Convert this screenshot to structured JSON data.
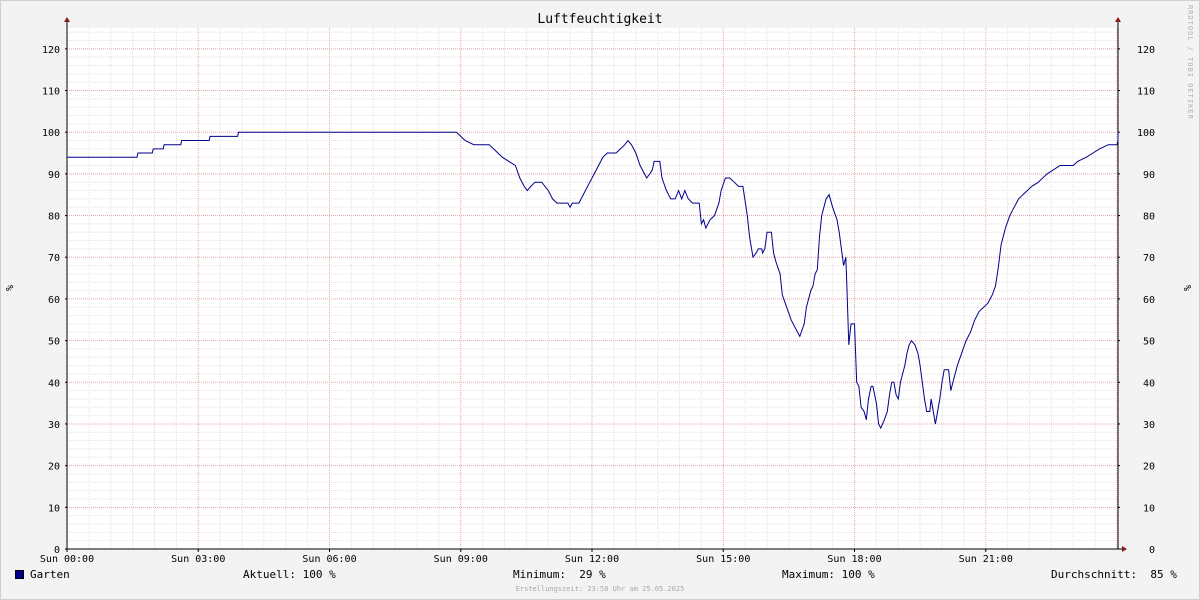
{
  "chart_data": {
    "type": "line",
    "title": "Luftfeuchtigkeit",
    "ylabel": "%",
    "ylim": [
      0,
      125
    ],
    "yticks": [
      0,
      10,
      20,
      30,
      40,
      50,
      60,
      70,
      80,
      90,
      100,
      110,
      120
    ],
    "xlim_hours": [
      0,
      24
    ],
    "x_ticks": [
      {
        "hour": 0,
        "label": "Sun 00:00"
      },
      {
        "hour": 3,
        "label": "Sun 03:00"
      },
      {
        "hour": 6,
        "label": "Sun 06:00"
      },
      {
        "hour": 9,
        "label": "Sun 09:00"
      },
      {
        "hour": 12,
        "label": "Sun 12:00"
      },
      {
        "hour": 15,
        "label": "Sun 15:00"
      },
      {
        "hour": 18,
        "label": "Sun 18:00"
      },
      {
        "hour": 21,
        "label": "Sun 21:00"
      }
    ],
    "grid": true,
    "series": [
      {
        "name": "Garten",
        "color": "#00008b",
        "points": [
          [
            0,
            94
          ],
          [
            1.6,
            94
          ],
          [
            1.62,
            95
          ],
          [
            1.95,
            95
          ],
          [
            1.97,
            96
          ],
          [
            2.2,
            96
          ],
          [
            2.22,
            97
          ],
          [
            2.6,
            97
          ],
          [
            2.62,
            98
          ],
          [
            3.25,
            98
          ],
          [
            3.27,
            99
          ],
          [
            3.9,
            99
          ],
          [
            3.92,
            100
          ],
          [
            8.9,
            100
          ],
          [
            9.0,
            99
          ],
          [
            9.1,
            98
          ],
          [
            9.3,
            97
          ],
          [
            9.65,
            97
          ],
          [
            9.75,
            96
          ],
          [
            9.85,
            95
          ],
          [
            9.95,
            94
          ],
          [
            10.1,
            93
          ],
          [
            10.25,
            92
          ],
          [
            10.35,
            89
          ],
          [
            10.45,
            87
          ],
          [
            10.52,
            86
          ],
          [
            10.6,
            87
          ],
          [
            10.7,
            88
          ],
          [
            10.85,
            88
          ],
          [
            11.0,
            86
          ],
          [
            11.1,
            84
          ],
          [
            11.2,
            83
          ],
          [
            11.45,
            83
          ],
          [
            11.5,
            82
          ],
          [
            11.55,
            83
          ],
          [
            11.7,
            83
          ],
          [
            11.85,
            86
          ],
          [
            11.95,
            88
          ],
          [
            12.05,
            90
          ],
          [
            12.15,
            92
          ],
          [
            12.25,
            94
          ],
          [
            12.35,
            95
          ],
          [
            12.55,
            95
          ],
          [
            12.65,
            96
          ],
          [
            12.75,
            97
          ],
          [
            12.82,
            98
          ],
          [
            12.9,
            97
          ],
          [
            13.0,
            95
          ],
          [
            13.1,
            92
          ],
          [
            13.2,
            90
          ],
          [
            13.25,
            89
          ],
          [
            13.32,
            90
          ],
          [
            13.38,
            91
          ],
          [
            13.42,
            93
          ],
          [
            13.55,
            93
          ],
          [
            13.6,
            89
          ],
          [
            13.7,
            86
          ],
          [
            13.8,
            84
          ],
          [
            13.9,
            84
          ],
          [
            13.98,
            86
          ],
          [
            14.05,
            84
          ],
          [
            14.12,
            86
          ],
          [
            14.2,
            84
          ],
          [
            14.3,
            83
          ],
          [
            14.45,
            83
          ],
          [
            14.5,
            78
          ],
          [
            14.55,
            79
          ],
          [
            14.6,
            77
          ],
          [
            14.7,
            79
          ],
          [
            14.8,
            80
          ],
          [
            14.9,
            83
          ],
          [
            14.95,
            86
          ],
          [
            15.05,
            89
          ],
          [
            15.15,
            89
          ],
          [
            15.25,
            88
          ],
          [
            15.35,
            87
          ],
          [
            15.45,
            87
          ],
          [
            15.55,
            80
          ],
          [
            15.6,
            75
          ],
          [
            15.68,
            70
          ],
          [
            15.75,
            71
          ],
          [
            15.8,
            72
          ],
          [
            15.88,
            72
          ],
          [
            15.9,
            71
          ],
          [
            15.95,
            72
          ],
          [
            16.0,
            76
          ],
          [
            16.1,
            76
          ],
          [
            16.15,
            71
          ],
          [
            16.2,
            69
          ],
          [
            16.3,
            66
          ],
          [
            16.35,
            61
          ],
          [
            16.45,
            58
          ],
          [
            16.55,
            55
          ],
          [
            16.65,
            53
          ],
          [
            16.75,
            51
          ],
          [
            16.85,
            54
          ],
          [
            16.9,
            58
          ],
          [
            17.0,
            62
          ],
          [
            17.05,
            63
          ],
          [
            17.1,
            66
          ],
          [
            17.15,
            67
          ],
          [
            17.2,
            75
          ],
          [
            17.25,
            80
          ],
          [
            17.35,
            84
          ],
          [
            17.42,
            85
          ],
          [
            17.5,
            82
          ],
          [
            17.6,
            79
          ],
          [
            17.65,
            76
          ],
          [
            17.7,
            72
          ],
          [
            17.75,
            68
          ],
          [
            17.8,
            70
          ],
          [
            17.82,
            65
          ],
          [
            17.87,
            49
          ],
          [
            17.92,
            54
          ],
          [
            18.0,
            54
          ],
          [
            18.05,
            40
          ],
          [
            18.1,
            39
          ],
          [
            18.15,
            34
          ],
          [
            18.22,
            33
          ],
          [
            18.27,
            31
          ],
          [
            18.32,
            36
          ],
          [
            18.38,
            39
          ],
          [
            18.42,
            39
          ],
          [
            18.5,
            35
          ],
          [
            18.55,
            30
          ],
          [
            18.6,
            29
          ],
          [
            18.68,
            31
          ],
          [
            18.75,
            33
          ],
          [
            18.8,
            37
          ],
          [
            18.85,
            40
          ],
          [
            18.9,
            40
          ],
          [
            18.95,
            37
          ],
          [
            19.0,
            36
          ],
          [
            19.05,
            40
          ],
          [
            19.1,
            42
          ],
          [
            19.15,
            44
          ],
          [
            19.2,
            47
          ],
          [
            19.25,
            49
          ],
          [
            19.3,
            50
          ],
          [
            19.38,
            49
          ],
          [
            19.45,
            47
          ],
          [
            19.5,
            44
          ],
          [
            19.55,
            40
          ],
          [
            19.6,
            36
          ],
          [
            19.65,
            33
          ],
          [
            19.72,
            33
          ],
          [
            19.75,
            36
          ],
          [
            19.8,
            33
          ],
          [
            19.85,
            30
          ],
          [
            19.9,
            33
          ],
          [
            19.95,
            36
          ],
          [
            20.0,
            40
          ],
          [
            20.05,
            43
          ],
          [
            20.15,
            43
          ],
          [
            20.2,
            38
          ],
          [
            20.25,
            40
          ],
          [
            20.35,
            44
          ],
          [
            20.45,
            47
          ],
          [
            20.55,
            50
          ],
          [
            20.65,
            52
          ],
          [
            20.75,
            55
          ],
          [
            20.85,
            57
          ],
          [
            20.95,
            58
          ],
          [
            21.05,
            59
          ],
          [
            21.15,
            61
          ],
          [
            21.22,
            63
          ],
          [
            21.28,
            67
          ],
          [
            21.35,
            73
          ],
          [
            21.45,
            77
          ],
          [
            21.55,
            80
          ],
          [
            21.65,
            82
          ],
          [
            21.75,
            84
          ],
          [
            21.85,
            85
          ],
          [
            21.95,
            86
          ],
          [
            22.05,
            87
          ],
          [
            22.2,
            88
          ],
          [
            22.4,
            90
          ],
          [
            22.55,
            91
          ],
          [
            22.7,
            92
          ],
          [
            23.0,
            92
          ],
          [
            23.1,
            93
          ],
          [
            23.3,
            94
          ],
          [
            23.45,
            95
          ],
          [
            23.6,
            96
          ],
          [
            23.8,
            97
          ],
          [
            24.0,
            97
          ],
          [
            24.1,
            98
          ],
          [
            24.35,
            98
          ],
          [
            24.45,
            99
          ],
          [
            24.7,
            99
          ],
          [
            24.8,
            100
          ],
          [
            25.0,
            100
          ]
        ]
      }
    ]
  },
  "watermark": "RRDTOOL / TOBI OETIKER",
  "legend": {
    "series_name": "Garten",
    "swatch_color": "#00008b",
    "current": "Aktuell: 100 %",
    "minimum": "Minimum:  29 %",
    "maximum": "Maximum: 100 %",
    "average": "Durchschnitt:  85 %"
  },
  "footer": "Erstellungszeit: 23:58 Uhr am 25.05.2025"
}
